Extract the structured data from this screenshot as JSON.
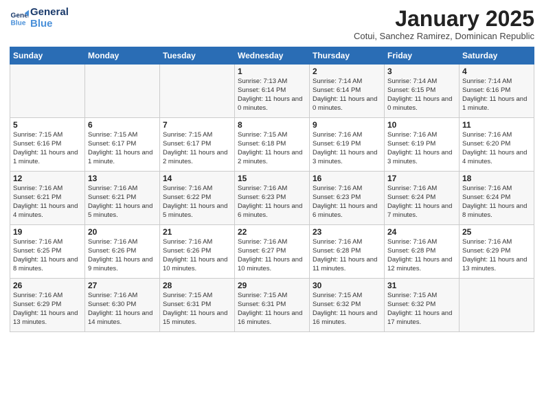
{
  "logo": {
    "line1": "General",
    "line2": "Blue"
  },
  "header": {
    "month": "January 2025",
    "location": "Cotui, Sanchez Ramirez, Dominican Republic"
  },
  "weekdays": [
    "Sunday",
    "Monday",
    "Tuesday",
    "Wednesday",
    "Thursday",
    "Friday",
    "Saturday"
  ],
  "weeks": [
    [
      {
        "day": "",
        "info": ""
      },
      {
        "day": "",
        "info": ""
      },
      {
        "day": "",
        "info": ""
      },
      {
        "day": "1",
        "info": "Sunrise: 7:13 AM\nSunset: 6:14 PM\nDaylight: 11 hours and 0 minutes."
      },
      {
        "day": "2",
        "info": "Sunrise: 7:14 AM\nSunset: 6:14 PM\nDaylight: 11 hours and 0 minutes."
      },
      {
        "day": "3",
        "info": "Sunrise: 7:14 AM\nSunset: 6:15 PM\nDaylight: 11 hours and 0 minutes."
      },
      {
        "day": "4",
        "info": "Sunrise: 7:14 AM\nSunset: 6:16 PM\nDaylight: 11 hours and 1 minute."
      }
    ],
    [
      {
        "day": "5",
        "info": "Sunrise: 7:15 AM\nSunset: 6:16 PM\nDaylight: 11 hours and 1 minute."
      },
      {
        "day": "6",
        "info": "Sunrise: 7:15 AM\nSunset: 6:17 PM\nDaylight: 11 hours and 1 minute."
      },
      {
        "day": "7",
        "info": "Sunrise: 7:15 AM\nSunset: 6:17 PM\nDaylight: 11 hours and 2 minutes."
      },
      {
        "day": "8",
        "info": "Sunrise: 7:15 AM\nSunset: 6:18 PM\nDaylight: 11 hours and 2 minutes."
      },
      {
        "day": "9",
        "info": "Sunrise: 7:16 AM\nSunset: 6:19 PM\nDaylight: 11 hours and 3 minutes."
      },
      {
        "day": "10",
        "info": "Sunrise: 7:16 AM\nSunset: 6:19 PM\nDaylight: 11 hours and 3 minutes."
      },
      {
        "day": "11",
        "info": "Sunrise: 7:16 AM\nSunset: 6:20 PM\nDaylight: 11 hours and 4 minutes."
      }
    ],
    [
      {
        "day": "12",
        "info": "Sunrise: 7:16 AM\nSunset: 6:21 PM\nDaylight: 11 hours and 4 minutes."
      },
      {
        "day": "13",
        "info": "Sunrise: 7:16 AM\nSunset: 6:21 PM\nDaylight: 11 hours and 5 minutes."
      },
      {
        "day": "14",
        "info": "Sunrise: 7:16 AM\nSunset: 6:22 PM\nDaylight: 11 hours and 5 minutes."
      },
      {
        "day": "15",
        "info": "Sunrise: 7:16 AM\nSunset: 6:23 PM\nDaylight: 11 hours and 6 minutes."
      },
      {
        "day": "16",
        "info": "Sunrise: 7:16 AM\nSunset: 6:23 PM\nDaylight: 11 hours and 6 minutes."
      },
      {
        "day": "17",
        "info": "Sunrise: 7:16 AM\nSunset: 6:24 PM\nDaylight: 11 hours and 7 minutes."
      },
      {
        "day": "18",
        "info": "Sunrise: 7:16 AM\nSunset: 6:24 PM\nDaylight: 11 hours and 8 minutes."
      }
    ],
    [
      {
        "day": "19",
        "info": "Sunrise: 7:16 AM\nSunset: 6:25 PM\nDaylight: 11 hours and 8 minutes."
      },
      {
        "day": "20",
        "info": "Sunrise: 7:16 AM\nSunset: 6:26 PM\nDaylight: 11 hours and 9 minutes."
      },
      {
        "day": "21",
        "info": "Sunrise: 7:16 AM\nSunset: 6:26 PM\nDaylight: 11 hours and 10 minutes."
      },
      {
        "day": "22",
        "info": "Sunrise: 7:16 AM\nSunset: 6:27 PM\nDaylight: 11 hours and 10 minutes."
      },
      {
        "day": "23",
        "info": "Sunrise: 7:16 AM\nSunset: 6:28 PM\nDaylight: 11 hours and 11 minutes."
      },
      {
        "day": "24",
        "info": "Sunrise: 7:16 AM\nSunset: 6:28 PM\nDaylight: 11 hours and 12 minutes."
      },
      {
        "day": "25",
        "info": "Sunrise: 7:16 AM\nSunset: 6:29 PM\nDaylight: 11 hours and 13 minutes."
      }
    ],
    [
      {
        "day": "26",
        "info": "Sunrise: 7:16 AM\nSunset: 6:29 PM\nDaylight: 11 hours and 13 minutes."
      },
      {
        "day": "27",
        "info": "Sunrise: 7:16 AM\nSunset: 6:30 PM\nDaylight: 11 hours and 14 minutes."
      },
      {
        "day": "28",
        "info": "Sunrise: 7:15 AM\nSunset: 6:31 PM\nDaylight: 11 hours and 15 minutes."
      },
      {
        "day": "29",
        "info": "Sunrise: 7:15 AM\nSunset: 6:31 PM\nDaylight: 11 hours and 16 minutes."
      },
      {
        "day": "30",
        "info": "Sunrise: 7:15 AM\nSunset: 6:32 PM\nDaylight: 11 hours and 16 minutes."
      },
      {
        "day": "31",
        "info": "Sunrise: 7:15 AM\nSunset: 6:32 PM\nDaylight: 11 hours and 17 minutes."
      },
      {
        "day": "",
        "info": ""
      }
    ]
  ]
}
